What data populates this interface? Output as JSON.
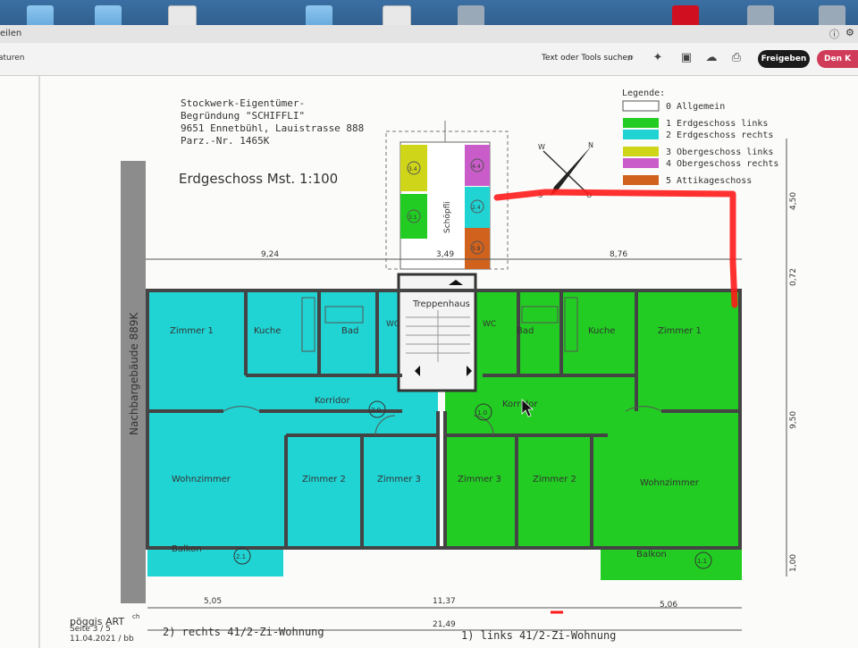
{
  "toolbar": {
    "tab_label": "aturen",
    "menu_label": "eilen",
    "tools_search": "Text oder Tools suchen",
    "share_button": "Freigeben",
    "red_button": "Den K"
  },
  "plan": {
    "header_lines": [
      "Stockwerk-Eigentümer-",
      "Begründung \"SCHIFFLI\"",
      "9651 Ennetbühl, Lauistrasse 888",
      "Parz.-Nr. 1465K"
    ],
    "title": "Erdgeschoss Mst. 1:100",
    "legend_title": "Legende:",
    "legend": [
      {
        "label": "0 Allgemein",
        "color": "#ffffff"
      },
      {
        "label": "1 Erdgeschoss links",
        "color": "#22cc22"
      },
      {
        "label": "2 Erdgeschoss rechts",
        "color": "#20d4d4"
      },
      {
        "label": "3 Obergeschoss links",
        "color": "#cfd61a"
      },
      {
        "label": "4 Obergeschoss rechts",
        "color": "#c95cc9"
      },
      {
        "label": "5 Attikageschoss",
        "color": "#d0621e"
      }
    ],
    "neighbor": "Nachbargebäude 889K",
    "rooms": {
      "zimmer1_left": "Zimmer 1",
      "kuche_left": "Kuche",
      "bad_left": "Bad",
      "wc_left": "WC",
      "treppenhaus": "Treppenhaus",
      "wc_right": "WC",
      "bad_right": "Bad",
      "kuche_right": "Kuche",
      "zimmer1_right": "Zimmer 1",
      "korridor_left": "Korridor",
      "korridor_right": "Korridor",
      "wohnzimmer_left": "Wohnzimmer",
      "zimmer2_left": "Zimmer 2",
      "zimmer3_left": "Zimmer 3",
      "zimmer3_right": "Zimmer 3",
      "zimmer2_right": "Zimmer 2",
      "wohnzimmer_right": "Wohnzimmer",
      "balkon_left": "Balkon",
      "balkon_right": "Balkon",
      "schopfli": "Schöpfli"
    },
    "circle_labels": {
      "korr_left": "2.0",
      "korr_right": "1.0",
      "balk_left": "2.1",
      "balk_right": "1.1",
      "s34": "3.4",
      "s44": "4.4",
      "s31": "3.1",
      "s24": "2.4",
      "s59": "5.9"
    },
    "dims": {
      "top_left": "9,24",
      "top_mid": "3,49",
      "top_right": "8,76",
      "bot_left": "5,05",
      "bot_mid": "11,37",
      "bot_right": "5,06",
      "bot_total": "21,49",
      "right_top": "4,50",
      "right_small": "0,72",
      "right_mid": "9,50",
      "right_bot": "1,00"
    },
    "footer": {
      "logo": "pöggis ART",
      "logo_suffix": "ch",
      "date": "11.04.2021 / bb",
      "page": "Seite 3 / 5",
      "caption_right": "2) rechts 41/2-Zi-Wohnung",
      "caption_left": "1) links 41/2-Zi-Wohnung"
    }
  }
}
